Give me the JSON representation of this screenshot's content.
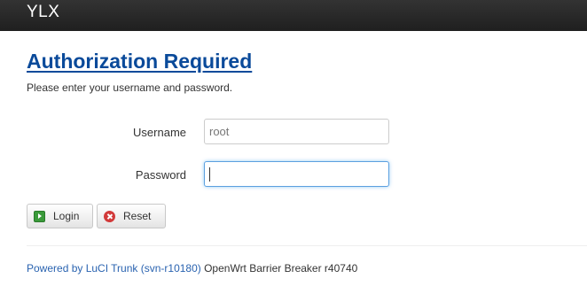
{
  "header": {
    "brand": "YLX"
  },
  "main": {
    "title": "Authorization Required",
    "description": "Please enter your username and password."
  },
  "form": {
    "username_label": "Username",
    "username_value": "root",
    "password_label": "Password",
    "password_value": ""
  },
  "buttons": {
    "login_label": "Login",
    "reset_label": "Reset"
  },
  "footer": {
    "link_text": "Powered by LuCI Trunk (svn-r10180)",
    "version_text": " OpenWrt Barrier Breaker r40740"
  },
  "colors": {
    "header_bg": "#222222",
    "title": "#0a4a9a",
    "link": "#2a63b0",
    "focus_border": "#5ca0e0",
    "login_icon": "#3a9a3a",
    "reset_icon": "#d23a3a"
  },
  "icons": {
    "login": "login-arrow-icon",
    "reset": "reset-x-icon"
  }
}
